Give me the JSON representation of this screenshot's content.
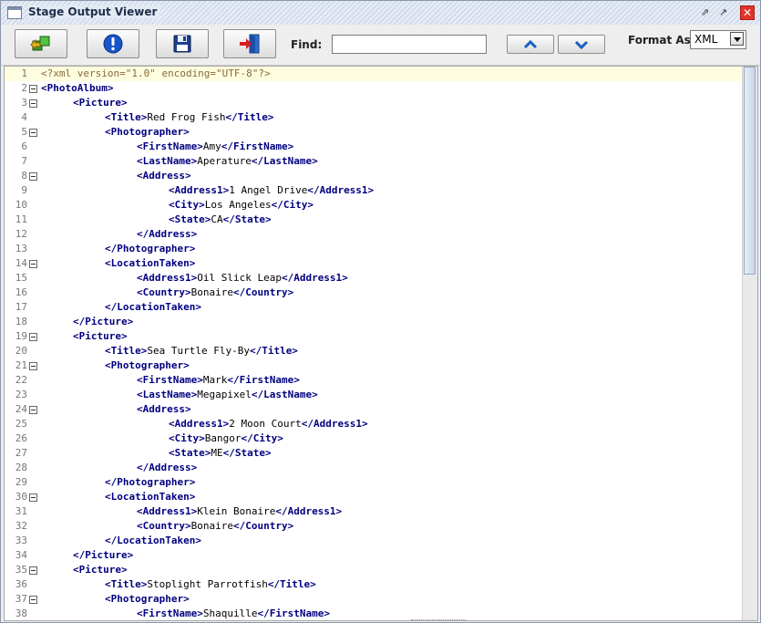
{
  "window": {
    "title": "Stage Output Viewer"
  },
  "toolbar": {
    "find_label": "Find:",
    "find_value": "",
    "format_label": "Format As:",
    "format_value": "XML"
  },
  "editor": {
    "lines": [
      {
        "n": "1",
        "indent": 0,
        "fold": false,
        "tokens": [
          {
            "t": "<?xml version=\"1.0\" encoding=\"UTF-8\"?>",
            "c": "decl"
          }
        ]
      },
      {
        "n": "2",
        "indent": 0,
        "fold": true,
        "tokens": [
          {
            "t": "<PhotoAlbum>",
            "c": "tag"
          }
        ]
      },
      {
        "n": "3",
        "indent": 1,
        "fold": true,
        "tokens": [
          {
            "t": "<Picture>",
            "c": "tag"
          }
        ]
      },
      {
        "n": "4",
        "indent": 2,
        "fold": false,
        "tokens": [
          {
            "t": "<Title>",
            "c": "tag"
          },
          {
            "t": "Red Frog Fish",
            "c": "txt"
          },
          {
            "t": "</Title>",
            "c": "tag"
          }
        ]
      },
      {
        "n": "5",
        "indent": 2,
        "fold": true,
        "tokens": [
          {
            "t": "<Photographer>",
            "c": "tag"
          }
        ]
      },
      {
        "n": "6",
        "indent": 3,
        "fold": false,
        "tokens": [
          {
            "t": "<FirstName>",
            "c": "tag"
          },
          {
            "t": "Amy",
            "c": "txt"
          },
          {
            "t": "</FirstName>",
            "c": "tag"
          }
        ]
      },
      {
        "n": "7",
        "indent": 3,
        "fold": false,
        "tokens": [
          {
            "t": "<LastName>",
            "c": "tag"
          },
          {
            "t": "Aperature",
            "c": "txt"
          },
          {
            "t": "</LastName>",
            "c": "tag"
          }
        ]
      },
      {
        "n": "8",
        "indent": 3,
        "fold": true,
        "tokens": [
          {
            "t": "<Address>",
            "c": "tag"
          }
        ]
      },
      {
        "n": "9",
        "indent": 4,
        "fold": false,
        "tokens": [
          {
            "t": "<Address1>",
            "c": "tag"
          },
          {
            "t": "1 Angel Drive",
            "c": "txt"
          },
          {
            "t": "</Address1>",
            "c": "tag"
          }
        ]
      },
      {
        "n": "10",
        "indent": 4,
        "fold": false,
        "tokens": [
          {
            "t": "<City>",
            "c": "tag"
          },
          {
            "t": "Los Angeles",
            "c": "txt"
          },
          {
            "t": "</City>",
            "c": "tag"
          }
        ]
      },
      {
        "n": "11",
        "indent": 4,
        "fold": false,
        "tokens": [
          {
            "t": "<State>",
            "c": "tag"
          },
          {
            "t": "CA",
            "c": "txt"
          },
          {
            "t": "</State>",
            "c": "tag"
          }
        ]
      },
      {
        "n": "12",
        "indent": 3,
        "fold": false,
        "tokens": [
          {
            "t": "</Address>",
            "c": "tag"
          }
        ]
      },
      {
        "n": "13",
        "indent": 2,
        "fold": false,
        "tokens": [
          {
            "t": "</Photographer>",
            "c": "tag"
          }
        ]
      },
      {
        "n": "14",
        "indent": 2,
        "fold": true,
        "tokens": [
          {
            "t": "<LocationTaken>",
            "c": "tag"
          }
        ]
      },
      {
        "n": "15",
        "indent": 3,
        "fold": false,
        "tokens": [
          {
            "t": "<Address1>",
            "c": "tag"
          },
          {
            "t": "Oil Slick Leap",
            "c": "txt"
          },
          {
            "t": "</Address1>",
            "c": "tag"
          }
        ]
      },
      {
        "n": "16",
        "indent": 3,
        "fold": false,
        "tokens": [
          {
            "t": "<Country>",
            "c": "tag"
          },
          {
            "t": "Bonaire",
            "c": "txt"
          },
          {
            "t": "</Country>",
            "c": "tag"
          }
        ]
      },
      {
        "n": "17",
        "indent": 2,
        "fold": false,
        "tokens": [
          {
            "t": "</LocationTaken>",
            "c": "tag"
          }
        ]
      },
      {
        "n": "18",
        "indent": 1,
        "fold": false,
        "tokens": [
          {
            "t": "</Picture>",
            "c": "tag"
          }
        ]
      },
      {
        "n": "19",
        "indent": 1,
        "fold": true,
        "tokens": [
          {
            "t": "<Picture>",
            "c": "tag"
          }
        ]
      },
      {
        "n": "20",
        "indent": 2,
        "fold": false,
        "tokens": [
          {
            "t": "<Title>",
            "c": "tag"
          },
          {
            "t": "Sea Turtle Fly-By",
            "c": "txt"
          },
          {
            "t": "</Title>",
            "c": "tag"
          }
        ]
      },
      {
        "n": "21",
        "indent": 2,
        "fold": true,
        "tokens": [
          {
            "t": "<Photographer>",
            "c": "tag"
          }
        ]
      },
      {
        "n": "22",
        "indent": 3,
        "fold": false,
        "tokens": [
          {
            "t": "<FirstName>",
            "c": "tag"
          },
          {
            "t": "Mark",
            "c": "txt"
          },
          {
            "t": "</FirstName>",
            "c": "tag"
          }
        ]
      },
      {
        "n": "23",
        "indent": 3,
        "fold": false,
        "tokens": [
          {
            "t": "<LastName>",
            "c": "tag"
          },
          {
            "t": "Megapixel",
            "c": "txt"
          },
          {
            "t": "</LastName>",
            "c": "tag"
          }
        ]
      },
      {
        "n": "24",
        "indent": 3,
        "fold": true,
        "tokens": [
          {
            "t": "<Address>",
            "c": "tag"
          }
        ]
      },
      {
        "n": "25",
        "indent": 4,
        "fold": false,
        "tokens": [
          {
            "t": "<Address1>",
            "c": "tag"
          },
          {
            "t": "2 Moon Court",
            "c": "txt"
          },
          {
            "t": "</Address1>",
            "c": "tag"
          }
        ]
      },
      {
        "n": "26",
        "indent": 4,
        "fold": false,
        "tokens": [
          {
            "t": "<City>",
            "c": "tag"
          },
          {
            "t": "Bangor",
            "c": "txt"
          },
          {
            "t": "</City>",
            "c": "tag"
          }
        ]
      },
      {
        "n": "27",
        "indent": 4,
        "fold": false,
        "tokens": [
          {
            "t": "<State>",
            "c": "tag"
          },
          {
            "t": "ME",
            "c": "txt"
          },
          {
            "t": "</State>",
            "c": "tag"
          }
        ]
      },
      {
        "n": "28",
        "indent": 3,
        "fold": false,
        "tokens": [
          {
            "t": "</Address>",
            "c": "tag"
          }
        ]
      },
      {
        "n": "29",
        "indent": 2,
        "fold": false,
        "tokens": [
          {
            "t": "</Photographer>",
            "c": "tag"
          }
        ]
      },
      {
        "n": "30",
        "indent": 2,
        "fold": true,
        "tokens": [
          {
            "t": "<LocationTaken>",
            "c": "tag"
          }
        ]
      },
      {
        "n": "31",
        "indent": 3,
        "fold": false,
        "tokens": [
          {
            "t": "<Address1>",
            "c": "tag"
          },
          {
            "t": "Klein Bonaire",
            "c": "txt"
          },
          {
            "t": "</Address1>",
            "c": "tag"
          }
        ]
      },
      {
        "n": "32",
        "indent": 3,
        "fold": false,
        "tokens": [
          {
            "t": "<Country>",
            "c": "tag"
          },
          {
            "t": "Bonaire",
            "c": "txt"
          },
          {
            "t": "</Country>",
            "c": "tag"
          }
        ]
      },
      {
        "n": "33",
        "indent": 2,
        "fold": false,
        "tokens": [
          {
            "t": "</LocationTaken>",
            "c": "tag"
          }
        ]
      },
      {
        "n": "34",
        "indent": 1,
        "fold": false,
        "tokens": [
          {
            "t": "</Picture>",
            "c": "tag"
          }
        ]
      },
      {
        "n": "35",
        "indent": 1,
        "fold": true,
        "tokens": [
          {
            "t": "<Picture>",
            "c": "tag"
          }
        ]
      },
      {
        "n": "36",
        "indent": 2,
        "fold": false,
        "tokens": [
          {
            "t": "<Title>",
            "c": "tag"
          },
          {
            "t": "Stoplight Parrotfish",
            "c": "txt"
          },
          {
            "t": "</Title>",
            "c": "tag"
          }
        ]
      },
      {
        "n": "37",
        "indent": 2,
        "fold": true,
        "tokens": [
          {
            "t": "<Photographer>",
            "c": "tag"
          }
        ]
      },
      {
        "n": "38",
        "indent": 3,
        "fold": false,
        "tokens": [
          {
            "t": "<FirstName>",
            "c": "tag"
          },
          {
            "t": "Shaquille",
            "c": "txt"
          },
          {
            "t": "</FirstName>",
            "c": "tag"
          }
        ]
      }
    ]
  }
}
